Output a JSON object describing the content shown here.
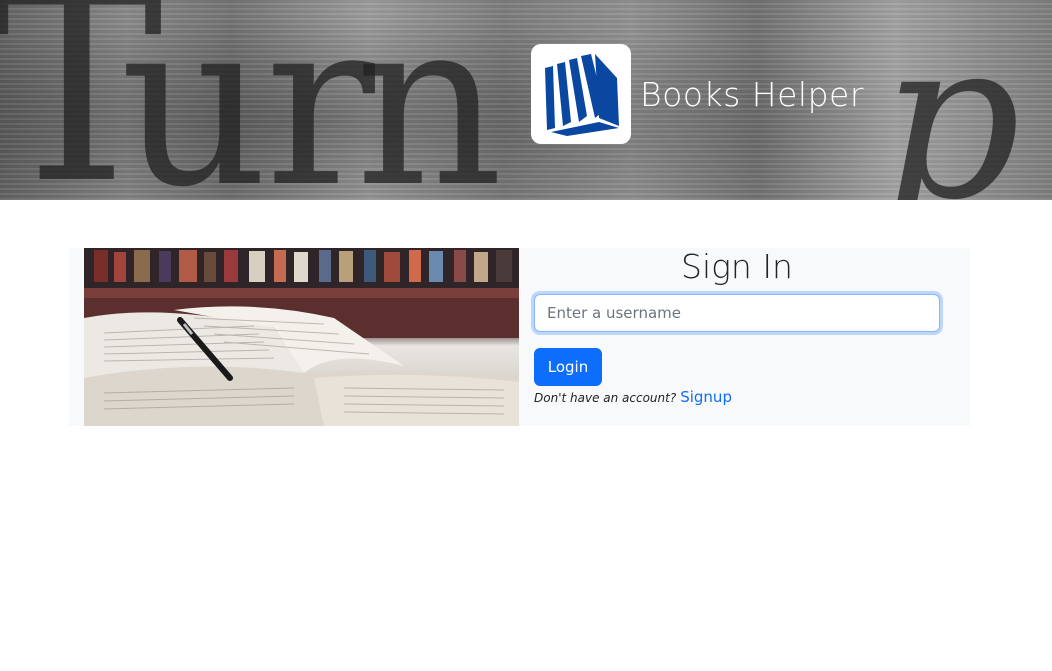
{
  "header": {
    "banner_word": "Turn p",
    "brand_title": "Books Helper",
    "logo_icon": "books-logo-icon"
  },
  "signin": {
    "title": "Sign In",
    "username_placeholder": "Enter a username",
    "username_value": "",
    "login_label": "Login",
    "no_account_text": "Don't have an account?",
    "signup_label": "Signup"
  },
  "colors": {
    "primary": "#0d6efd",
    "card_background": "#f8f9fa",
    "logo_blue": "#0a47a0"
  }
}
